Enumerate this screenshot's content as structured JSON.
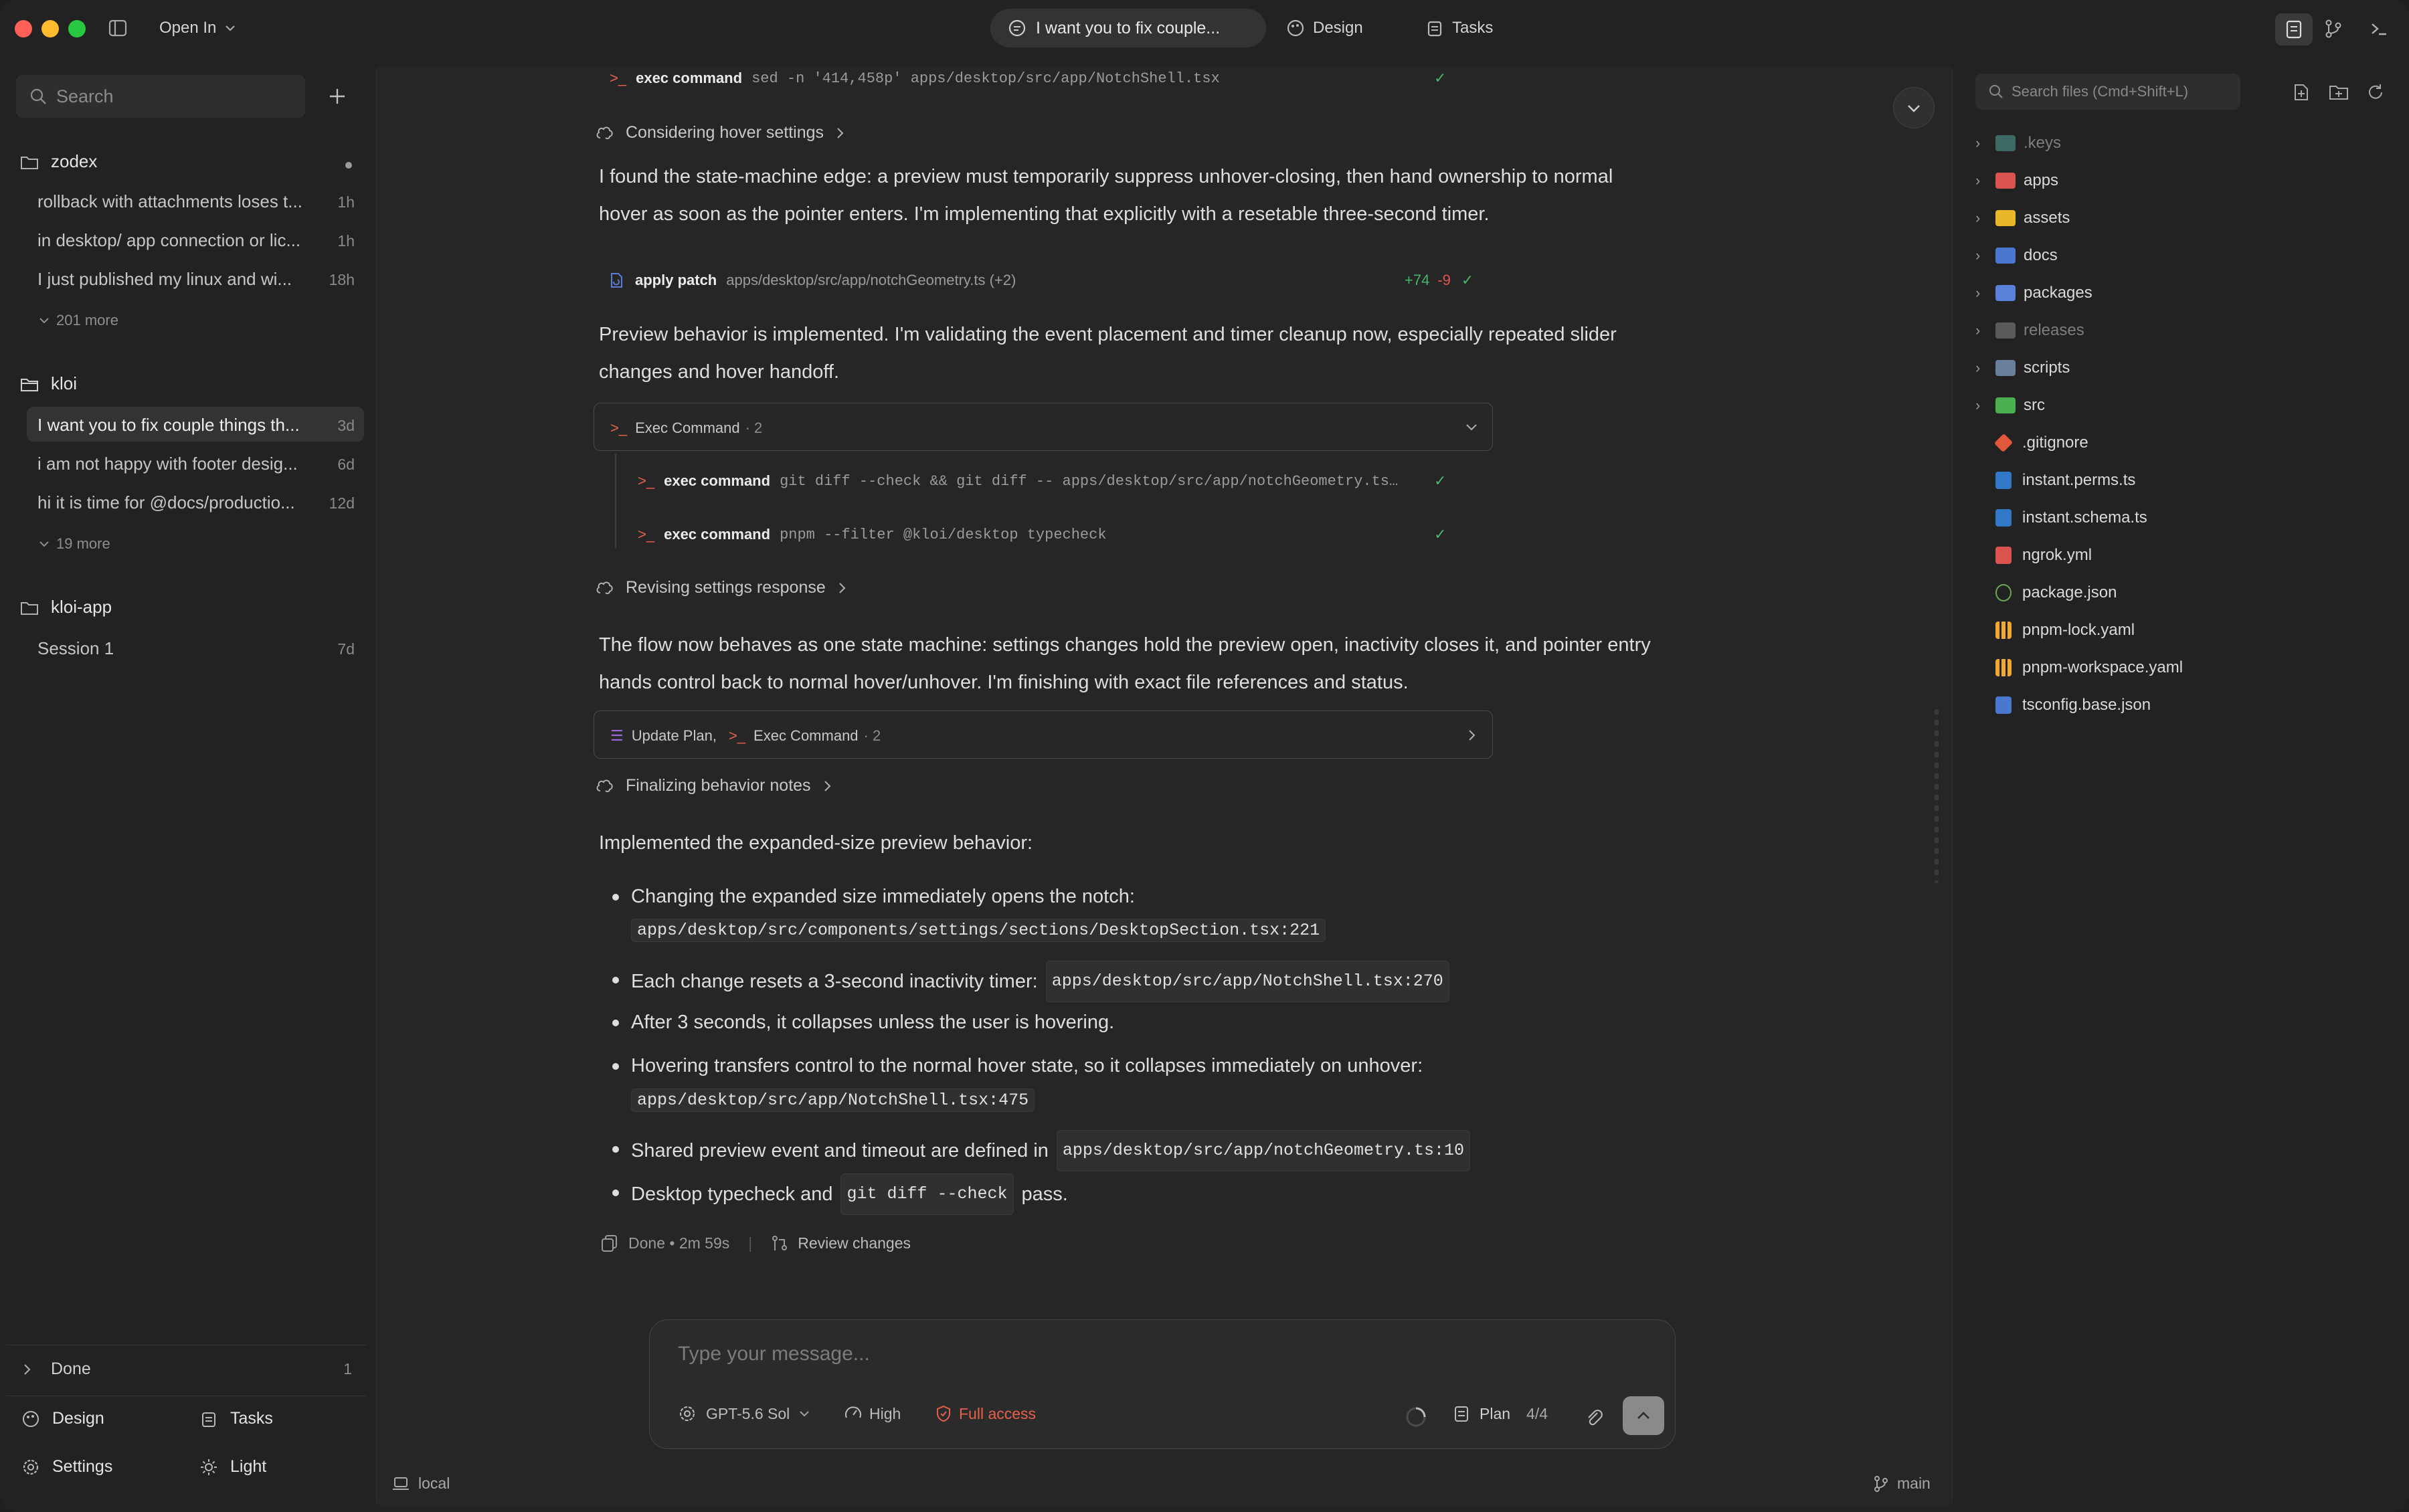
{
  "titlebar": {
    "open_in": "Open In",
    "chat_title": "I want you to fix couple...",
    "design": "Design",
    "tasks": "Tasks"
  },
  "sidebar": {
    "search_placeholder": "Search",
    "groups": [
      {
        "name": "zodex",
        "threads": [
          {
            "title": "rollback with attachments loses t...",
            "age": "1h"
          },
          {
            "title": "in desktop/ app connection or lic...",
            "age": "1h"
          },
          {
            "title": "I just published my linux and wi...",
            "age": "18h"
          }
        ],
        "more": "201 more"
      },
      {
        "name": "kloi",
        "threads": [
          {
            "title": "I want you to fix couple things th...",
            "age": "3d"
          },
          {
            "title": "i am not happy with footer desig...",
            "age": "6d"
          },
          {
            "title": "hi it is time for @docs/productio...",
            "age": "12d"
          }
        ],
        "more": "19 more"
      },
      {
        "name": "kloi-app",
        "threads": [
          {
            "title": "Session 1",
            "age": "7d"
          }
        ]
      }
    ],
    "done_label": "Done",
    "done_count": "1",
    "footer": {
      "design": "Design",
      "tasks": "Tasks",
      "settings": "Settings",
      "light": "Light"
    }
  },
  "chat": {
    "exec1": {
      "label": "exec command",
      "arg": "sed -n '414,458p' apps/desktop/src/app/NotchShell.tsx"
    },
    "think1": "Considering hover settings",
    "para1a": "I found the state-machine edge: a preview must temporarily suppress unhover-closing, then hand ownership to normal",
    "para1b": "hover as soon as the pointer enters. I'm implementing that explicitly with a resetable three-second timer.",
    "patch": {
      "label": "apply patch",
      "arg": "apps/desktop/src/app/notchGeometry.ts (+2)",
      "added": "+74",
      "removed": "-9"
    },
    "para2a": "Preview behavior is implemented. I'm validating the event placement and timer cleanup now, especially repeated slider",
    "para2b": "changes and hover handoff.",
    "group1": {
      "title": "Exec Command",
      "count": "· 2",
      "items": [
        {
          "label": "exec command",
          "arg": "git diff --check && git diff -- apps/desktop/src/app/notchGeometry.ts…"
        },
        {
          "label": "exec command",
          "arg": "pnpm --filter @kloi/desktop typecheck"
        }
      ]
    },
    "think2": "Revising settings response",
    "para3a": "The flow now behaves as one state machine: settings changes hold the preview open, inactivity closes it, and pointer entry",
    "para3b": "hands control back to normal hover/unhover. I'm finishing with exact file references and status.",
    "group2": {
      "a": "Update Plan,",
      "b": "Exec Command",
      "count": "· 2"
    },
    "think3": "Finalizing behavior notes",
    "summary": "Implemented the expanded-size preview behavior:",
    "bullets": {
      "b1": "Changing the expanded size immediately opens the notch:",
      "b1code": "apps/desktop/src/components/settings/sections/DesktopSection.tsx:221",
      "b2": "Each change resets a 3-second inactivity timer:",
      "b2code": "apps/desktop/src/app/NotchShell.tsx:270",
      "b3": "After 3 seconds, it collapses unless the user is hovering.",
      "b4": "Hovering transfers control to the normal hover state, so it collapses immediately on unhover:",
      "b4code": "apps/desktop/src/app/NotchShell.tsx:475",
      "b5": "Shared preview event and timeout are defined in",
      "b5code": "apps/desktop/src/app/notchGeometry.ts:10",
      "b6a": "Desktop typecheck and",
      "b6code": "git diff --check",
      "b6b": "pass."
    },
    "done": "Done • 2m 59s",
    "review": "Review changes"
  },
  "composer": {
    "placeholder": "Type your message...",
    "model": "GPT-5.6 Sol",
    "effort": "High",
    "access": "Full access",
    "plan": "Plan",
    "plan_count": "4/4"
  },
  "footer": {
    "env": "local",
    "branch": "main"
  },
  "files": {
    "search_placeholder": "Search files (Cmd+Shift+L)",
    "folders": [
      ".keys",
      "apps",
      "assets",
      "docs",
      "packages",
      "releases",
      "scripts",
      "src"
    ],
    "items": [
      ".gitignore",
      "instant.perms.ts",
      "instant.schema.ts",
      "ngrok.yml",
      "package.json",
      "pnpm-lock.yaml",
      "pnpm-workspace.yaml",
      "tsconfig.base.json"
    ]
  },
  "colors": {
    "accent_red": "#e8604c",
    "green": "#46b46a",
    "bg": "#232324"
  }
}
